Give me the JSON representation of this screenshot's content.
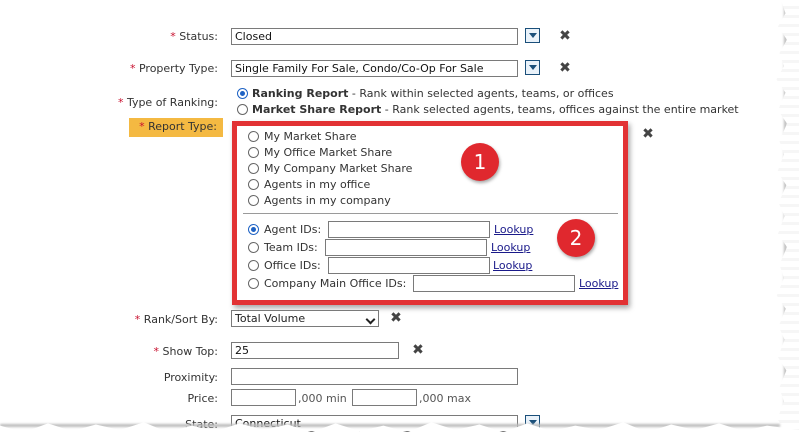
{
  "form": {
    "status": {
      "label": "Status:",
      "value": "Closed"
    },
    "property_type": {
      "label": "Property Type:",
      "value": "Single Family For Sale, Condo/Co-Op For Sale"
    },
    "type_of_ranking": {
      "label": "Type of Ranking:",
      "options": [
        {
          "title": "Ranking Report",
          "desc": " - Rank within selected agents, teams, or offices",
          "selected": true
        },
        {
          "title": "Market Share Report",
          "desc": " - Rank selected agents, teams, offices against the entire market",
          "selected": false
        }
      ]
    },
    "report_type": {
      "label": "Report Type:",
      "options_top": [
        "My Market Share",
        "My Office Market Share",
        "My Company Market Share",
        "Agents in my office",
        "Agents in my company"
      ],
      "id_options": [
        {
          "label": "Agent IDs:",
          "lookup": "Lookup",
          "selected": true
        },
        {
          "label": "Team IDs:",
          "lookup": "Lookup",
          "selected": false
        },
        {
          "label": "Office IDs:",
          "lookup": "Lookup",
          "selected": false
        },
        {
          "label": "Company Main Office IDs:",
          "lookup": "Lookup",
          "selected": false
        }
      ]
    },
    "rank_sort_by": {
      "label": "Rank/Sort By:",
      "value": "Total Volume"
    },
    "show_top": {
      "label": "Show Top:",
      "value": "25"
    },
    "proximity": {
      "label": "Proximity:",
      "value": ""
    },
    "price": {
      "label": "Price:",
      "min_suffix": ",000 min",
      "max_suffix": ",000 max"
    },
    "state": {
      "label": "State:",
      "value": "Connecticut"
    }
  },
  "annotations": {
    "badge1": "1",
    "badge2": "2"
  },
  "required_mark": "*",
  "colors": {
    "highlight": "#f4b942",
    "callout_red": "#e23234",
    "required": "#c8102e",
    "link": "#1a1a8a"
  },
  "icons": {
    "dropdown": "dropdown-arrow-icon",
    "clear": "close-x-icon"
  }
}
